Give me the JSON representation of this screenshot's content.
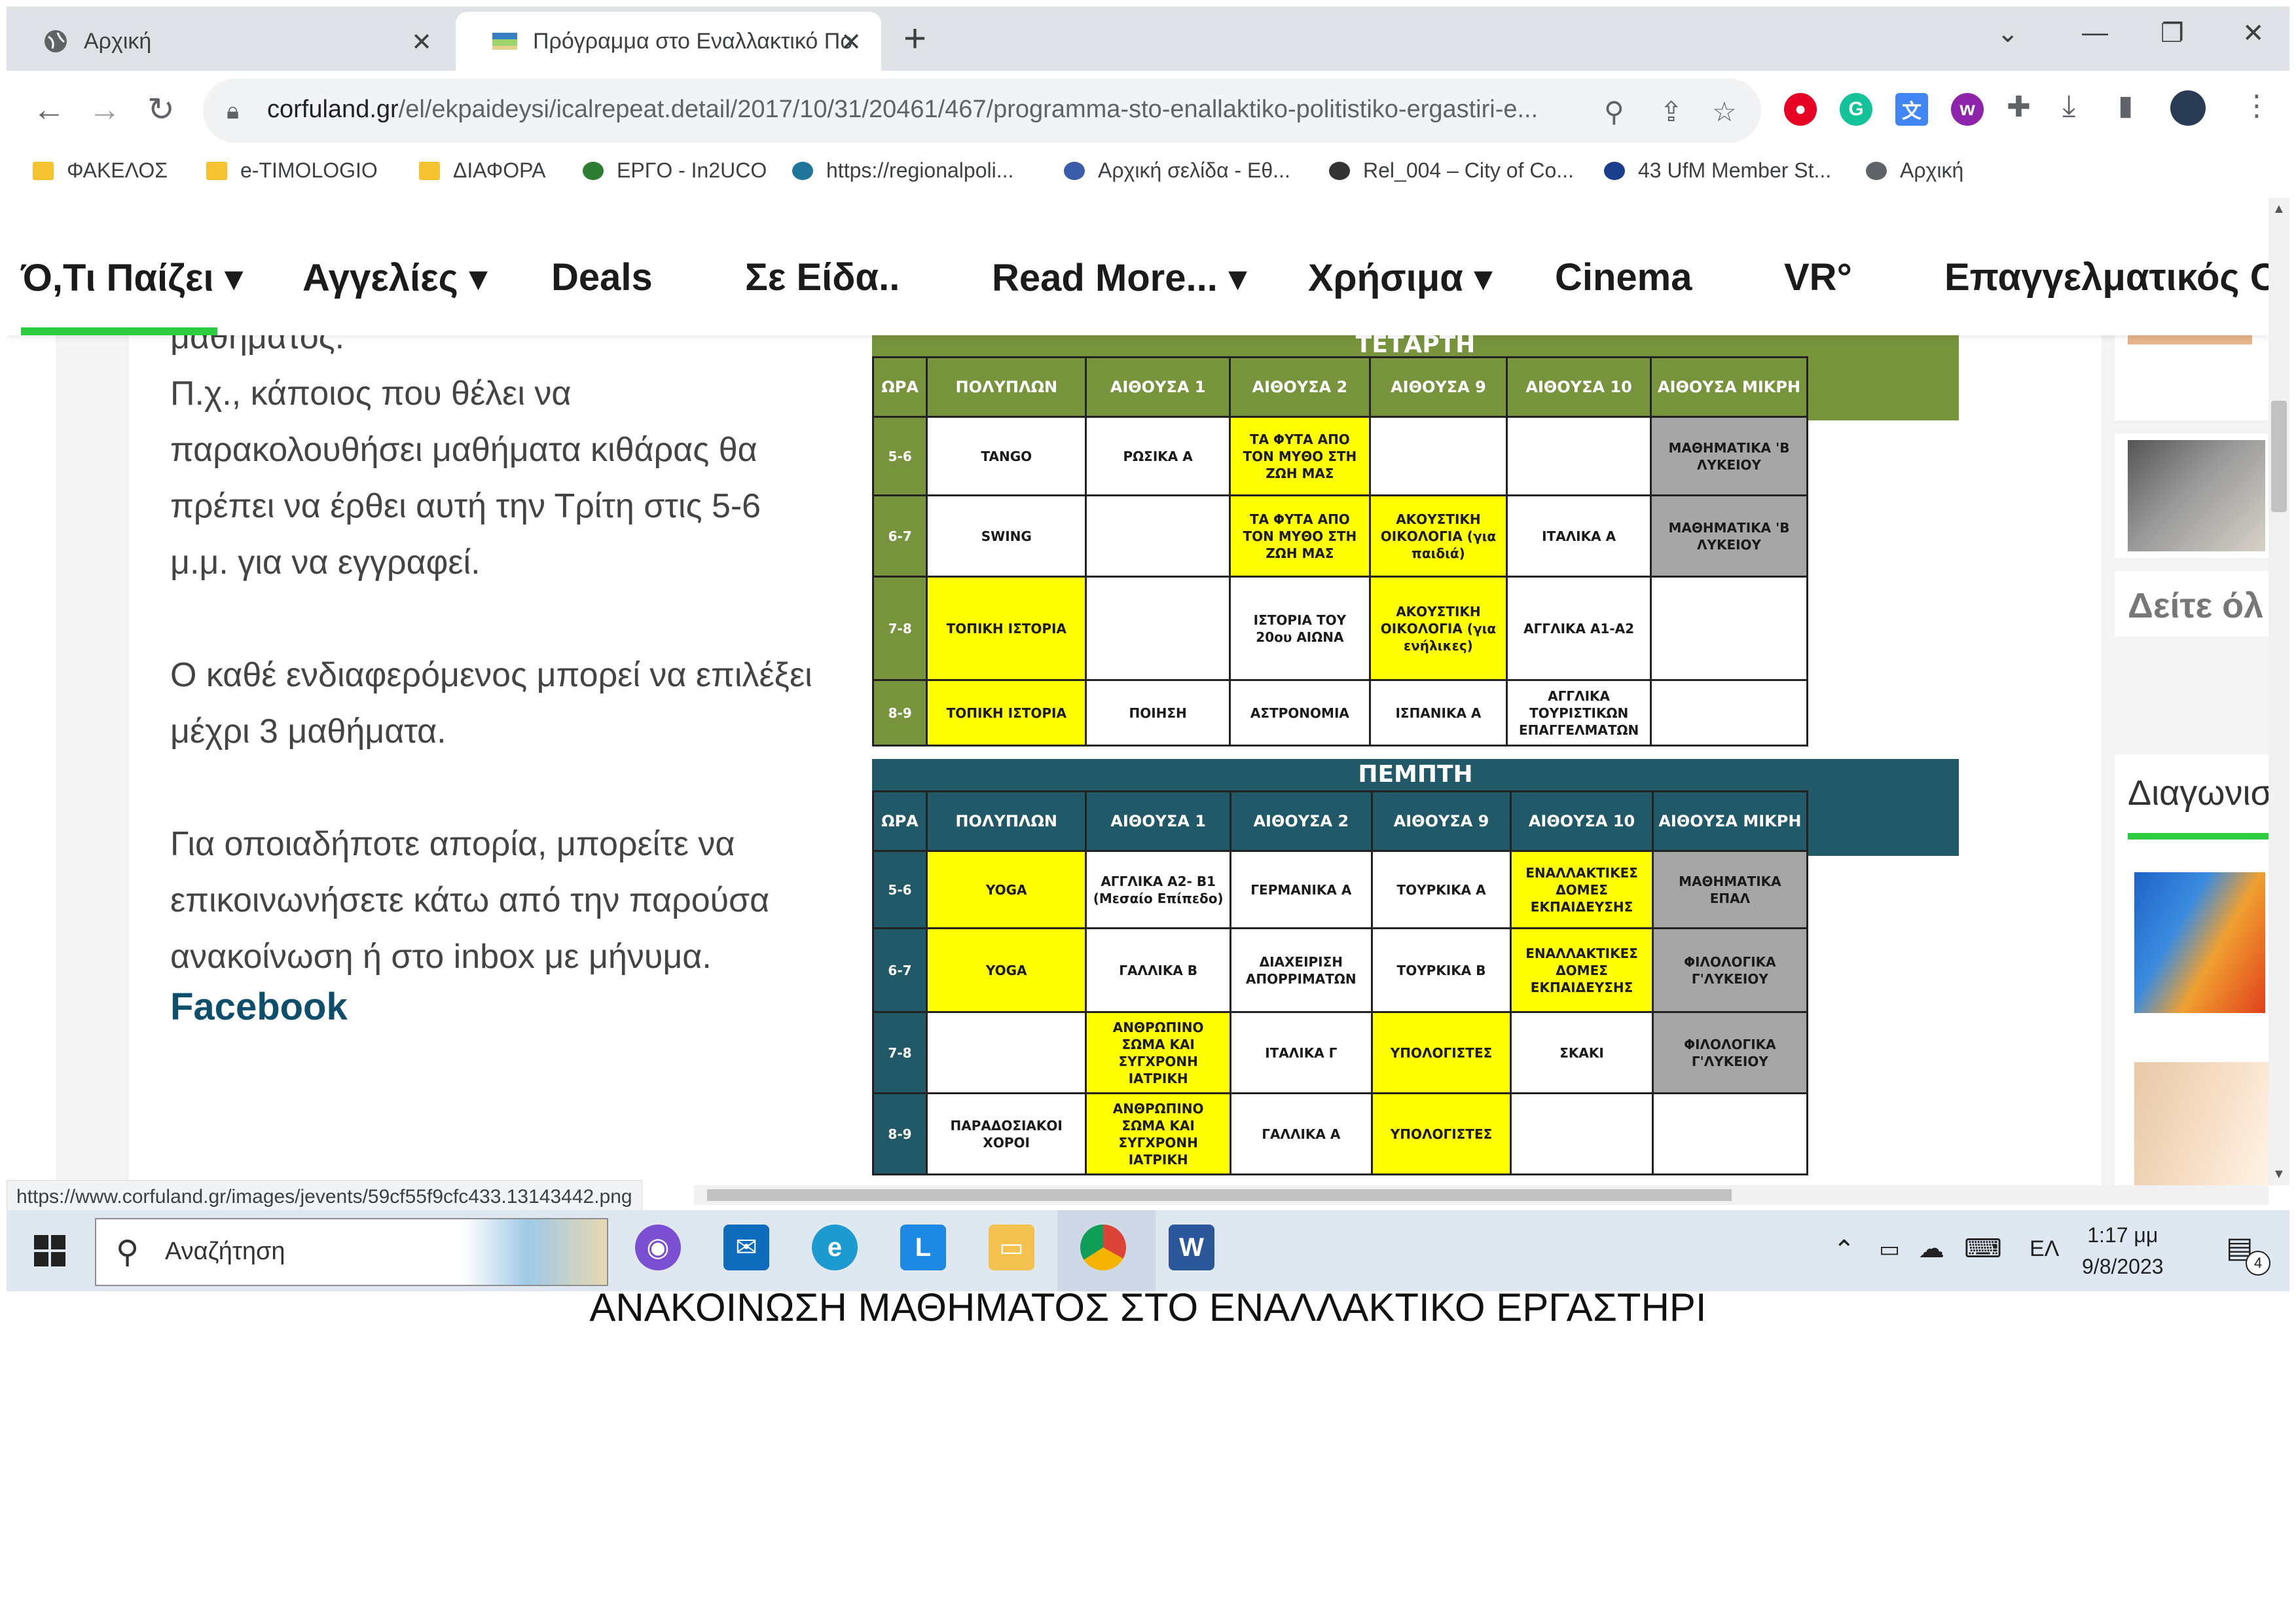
{
  "browser": {
    "tabs": [
      {
        "title": "Αρχική",
        "active": false
      },
      {
        "title": "Πρόγραμμα στο Εναλλακτικό Πο",
        "active": true
      }
    ],
    "url_host": "corfuland.gr",
    "url_path": "/el/ekpaideysi/icalrepeat.detail/2017/10/31/20461/467/programma-sto-enallaktiko-politistiko-ergastiri-e...",
    "bookmarks": [
      "ΦΑΚΕΛΟΣ",
      "e-TIMOLOGIO",
      "ΔΙΑΦΟΡΑ",
      "ΕΡΓΟ - In2UCO",
      "https://regionalpoli...",
      "Αρχική σελίδα - Εθ...",
      "Rel_004 – City of Co...",
      "43 UfM Member St...",
      "Αρχική"
    ],
    "status_url": "https://www.corfuland.gr/images/jevents/59cf55f9cfc433.13143442.png"
  },
  "site": {
    "menu": [
      "Ό,Τι Παίζει ▾",
      "Αγγελίες ▾",
      "Deals",
      "Σε Είδα..",
      "Read More... ▾",
      "Χρήσιμα ▾",
      "Cinema",
      "VR°",
      "Επαγγελματικός C"
    ],
    "article": {
      "cut_line": "μαθήματος.",
      "para1": "Π.χ., κάποιος που θέλει να παρακολουθήσει μαθήματα κιθάρας θα πρέπει να έρθει αυτή την Τρίτη στις 5-6 μ.μ. για να εγγραφεί.",
      "para2": "Ο καθέ ενδιαφερόμενος μπορεί να επιλέξει μέχρι 3 μαθήματα.",
      "para3": "Για οποιαδήποτε απορία, μπορείτε να επικοινωνήσετε κάτω από την παρούσα ανακοίνωση ή στο inbox με μήνυμα.",
      "facebook": "Facebook"
    },
    "sidebar": {
      "see_all": "Δείτε όλ",
      "contests": "Διαγωνισ"
    }
  },
  "schedule": {
    "headers": [
      "ΩΡΑ",
      "ΠΟΛΥΠΛΩΝ",
      "ΑΙΘΟΥΣΑ 1",
      "ΑΙΘΟΥΣΑ 2",
      "ΑΙΘΟΥΣΑ 9",
      "ΑΙΘΟΥΣΑ 10",
      "ΑΙΘΟΥΣΑ ΜΙΚΡΗ"
    ],
    "wednesday": {
      "day": "ΤΕΤΑΡΤΗ",
      "band_color": "#77933c",
      "rows": [
        {
          "hour": "5-6",
          "cells": [
            {
              "t": "TANGO",
              "c": "w"
            },
            {
              "t": "ΡΩΣΙΚΑ Α",
              "c": "w"
            },
            {
              "t": "ΤΑ ΦΥΤΑ ΑΠΟ ΤΟΝ ΜΥΘΟ ΣΤΗ ΖΩΗ ΜΑΣ",
              "c": "y"
            },
            {
              "t": "",
              "c": "w"
            },
            {
              "t": "",
              "c": "w"
            },
            {
              "t": "ΜΑΘΗΜΑΤΙΚΑ 'Β ΛΥΚΕΙΟΥ",
              "c": "g"
            }
          ]
        },
        {
          "hour": "6-7",
          "cells": [
            {
              "t": "SWING",
              "c": "w"
            },
            {
              "t": "",
              "c": "w"
            },
            {
              "t": "ΤΑ ΦΥΤΑ ΑΠΟ ΤΟΝ ΜΥΘΟ ΣΤΗ ΖΩΗ ΜΑΣ",
              "c": "y"
            },
            {
              "t": "ΑΚΟΥΣΤΙΚΗ ΟΙΚΟΛΟΓΙΑ (για παιδιά)",
              "c": "y"
            },
            {
              "t": "ΙΤΑΛΙΚΑ Α",
              "c": "w"
            },
            {
              "t": "ΜΑΘΗΜΑΤΙΚΑ 'Β ΛΥΚΕΙΟΥ",
              "c": "g"
            }
          ]
        },
        {
          "hour": "7-8",
          "cells": [
            {
              "t": "ΤΟΠΙΚΗ ΙΣΤΟΡΙΑ",
              "c": "y"
            },
            {
              "t": "",
              "c": "w"
            },
            {
              "t": "ΙΣΤΟΡΙΑ ΤΟΥ 20ου ΑΙΩΝΑ",
              "c": "w"
            },
            {
              "t": "ΑΚΟΥΣΤΙΚΗ ΟΙΚΟΛΟΓΙΑ (για ενήλικες)",
              "c": "y"
            },
            {
              "t": "ΑΓΓΛΙΚΑ Α1-Α2",
              "c": "w"
            },
            {
              "t": "",
              "c": "w"
            }
          ]
        },
        {
          "hour": "8-9",
          "cells": [
            {
              "t": "ΤΟΠΙΚΗ ΙΣΤΟΡΙΑ",
              "c": "y"
            },
            {
              "t": "ΠΟΙΗΣΗ",
              "c": "w"
            },
            {
              "t": "ΑΣΤΡΟΝΟΜΙΑ",
              "c": "w"
            },
            {
              "t": "ΙΣΠΑΝΙΚΑ Α",
              "c": "w"
            },
            {
              "t": "ΑΓΓΛΙΚΑ ΤΟΥΡΙΣΤΙΚΩΝ ΕΠΑΓΓΕΛΜΑΤΩΝ",
              "c": "w"
            },
            {
              "t": "",
              "c": "w"
            }
          ]
        }
      ]
    },
    "thursday": {
      "day": "ΠΕΜΠΤΗ",
      "band_color": "#215968",
      "rows": [
        {
          "hour": "5-6",
          "cells": [
            {
              "t": "YOGA",
              "c": "y"
            },
            {
              "t": "ΑΓΓΛΙΚΑ Α2- Β1 (Μεσαίο Επίπεδο)",
              "c": "w"
            },
            {
              "t": "ΓΕΡΜΑΝΙΚΑ Α",
              "c": "w"
            },
            {
              "t": "ΤΟΥΡΚΙΚΑ Α",
              "c": "w"
            },
            {
              "t": "ΕΝΑΛΛΑΚΤΙΚΕΣ ΔΟΜΕΣ ΕΚΠΑΙΔΕΥΣΗΣ",
              "c": "y"
            },
            {
              "t": "ΜΑΘΗΜΑΤΙΚΑ ΕΠΑΛ",
              "c": "g"
            }
          ]
        },
        {
          "hour": "6-7",
          "cells": [
            {
              "t": "YOGA",
              "c": "y"
            },
            {
              "t": "ΓΑΛΛΙΚΑ Β",
              "c": "w"
            },
            {
              "t": "ΔΙΑΧΕΙΡΙΣΗ ΑΠΟΡΡΙΜΑΤΩΝ",
              "c": "w"
            },
            {
              "t": "ΤΟΥΡΚΙΚΑ Β",
              "c": "w"
            },
            {
              "t": "ΕΝΑΛΛΑΚΤΙΚΕΣ ΔΟΜΕΣ ΕΚΠΑΙΔΕΥΣΗΣ",
              "c": "y"
            },
            {
              "t": "ΦΙΛΟΛΟΓΙΚΑ Γ'ΛΥΚΕΙΟΥ",
              "c": "g"
            }
          ]
        },
        {
          "hour": "7-8",
          "cells": [
            {
              "t": "",
              "c": "w"
            },
            {
              "t": "ΑΝΘΡΩΠΙΝΟ ΣΩΜΑ ΚΑΙ ΣΥΓΧΡΟΝΗ ΙΑΤΡΙΚΗ",
              "c": "y"
            },
            {
              "t": "ΙΤΑΛΙΚΑ Γ",
              "c": "w"
            },
            {
              "t": "ΥΠΟΛΟΓΙΣΤΕΣ",
              "c": "y"
            },
            {
              "t": "ΣΚΑΚΙ",
              "c": "w"
            },
            {
              "t": "ΦΙΛΟΛΟΓΙΚΑ Γ'ΛΥΚΕΙΟΥ",
              "c": "g"
            }
          ]
        },
        {
          "hour": "8-9",
          "cells": [
            {
              "t": "ΠΑΡΑΔΟΣΙΑΚΟΙ ΧΟΡΟΙ",
              "c": "w"
            },
            {
              "t": "ΑΝΘΡΩΠΙΝΟ ΣΩΜΑ ΚΑΙ ΣΥΓΧΡΟΝΗ ΙΑΤΡΙΚΗ",
              "c": "y"
            },
            {
              "t": "ΓΑΛΛΙΚΑ Α",
              "c": "w"
            },
            {
              "t": "ΥΠΟΛΟΓΙΣΤΕΣ",
              "c": "y"
            },
            {
              "t": "",
              "c": "w"
            },
            {
              "t": "",
              "c": "w"
            }
          ]
        }
      ]
    }
  },
  "taskbar": {
    "search_placeholder": "Αναζήτηση",
    "language": "ΕΛ",
    "time": "1:17 μμ",
    "date": "9/8/2023",
    "notification_count": "4"
  },
  "caption": "ΑΝΑΚΟΙΝΩΣΗ ΜΑΘΗΜΑΤΟΣ ΣΤΟ ΕΝΑΛΛΑΚΤΙΚΟ ΕΡΓΑΣΤΗΡΙ"
}
